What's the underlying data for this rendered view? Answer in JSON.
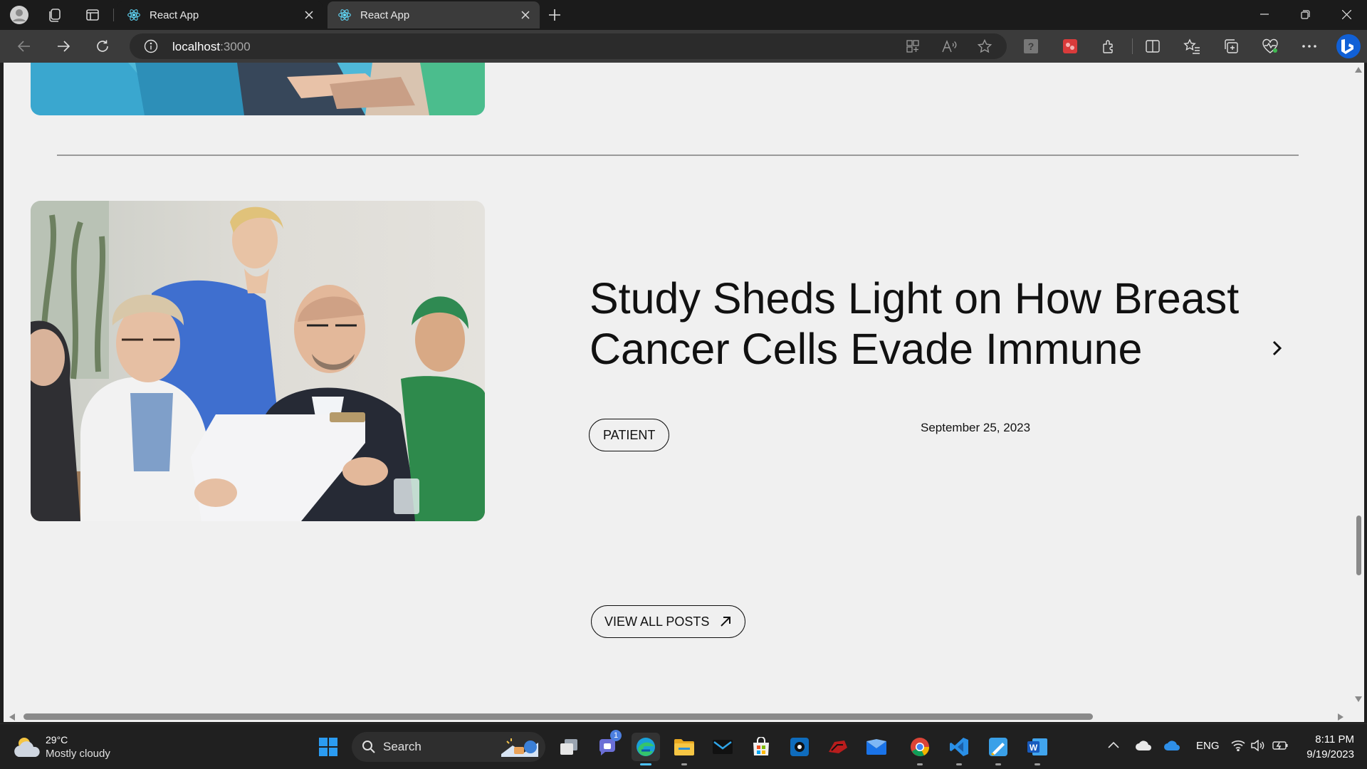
{
  "browser": {
    "tabs": [
      {
        "label": "React App",
        "active": false
      },
      {
        "label": "React App",
        "active": true
      }
    ],
    "url_host": "localhost",
    "url_port": ":3000"
  },
  "page": {
    "post": {
      "title": "Study Sheds Light on How Breast Cancer Cells Evade Immune",
      "tag": "PATIENT",
      "date": "September 25, 2023"
    },
    "view_all_label": "VIEW ALL POSTS"
  },
  "taskbar": {
    "weather_temp": "29°C",
    "weather_desc": "Mostly cloudy",
    "search_placeholder": "Search",
    "teams_badge": "1",
    "language": "ENG",
    "time": "8:11 PM",
    "date": "9/19/2023"
  },
  "colors": {
    "page_bg": "#f0f0f0",
    "accent": "#4cc2ff",
    "tab_active": "#3b3b3b"
  },
  "icons": [
    "profile-icon",
    "workspaces-icon",
    "tab-actions-icon",
    "react-logo-icon",
    "close-icon",
    "new-tab-icon",
    "back-icon",
    "forward-icon",
    "refresh-icon",
    "site-info-icon",
    "apps-icon",
    "read-aloud-icon",
    "favorite-star-icon",
    "help-extension-icon",
    "red-extension-icon",
    "extensions-icon",
    "split-screen-icon",
    "favorites-icon",
    "collections-icon",
    "browser-essentials-icon",
    "more-icon",
    "copilot-icon",
    "chevron-right-icon",
    "arrow-up-right-icon",
    "windows-start-icon",
    "search-icon"
  ]
}
